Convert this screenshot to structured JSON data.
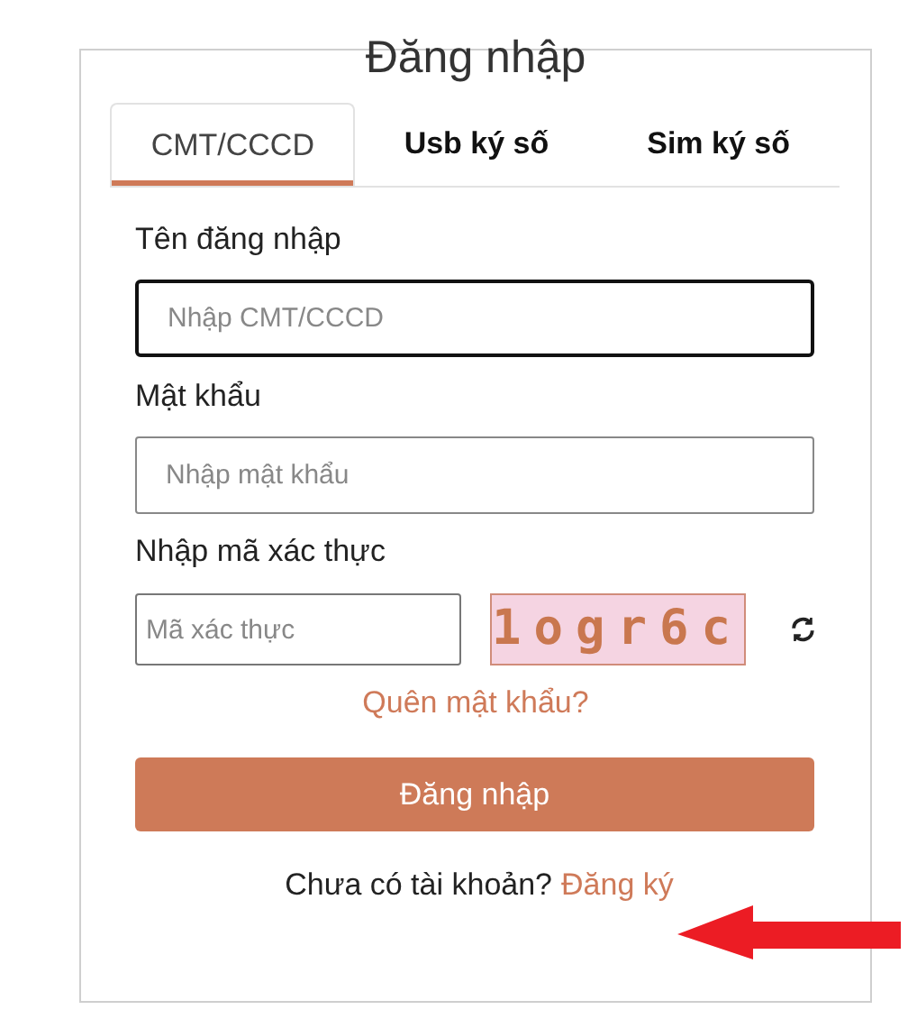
{
  "title": "Đăng nhập",
  "tabs": [
    {
      "label": "CMT/CCCD",
      "selected": true
    },
    {
      "label": "Usb ký số",
      "selected": false
    },
    {
      "label": "Sim ký số",
      "selected": false
    }
  ],
  "fields": [
    {
      "label": "Tên đăng nhập",
      "placeholder": "Nhập CMT/CCCD",
      "focused": true
    },
    {
      "label": "Mật khẩu",
      "placeholder": "Nhập mật khẩu",
      "focused": false
    }
  ],
  "captcha": {
    "label": "Nhập mã xác thực",
    "placeholder": "Mã xác thực",
    "code": "1ogr6c"
  },
  "forgot_link": "Quên mật khẩu?",
  "submit_button": "Đăng nhập",
  "signup": {
    "prompt": "Chưa có tài khoản?",
    "link": "Đăng ký"
  }
}
